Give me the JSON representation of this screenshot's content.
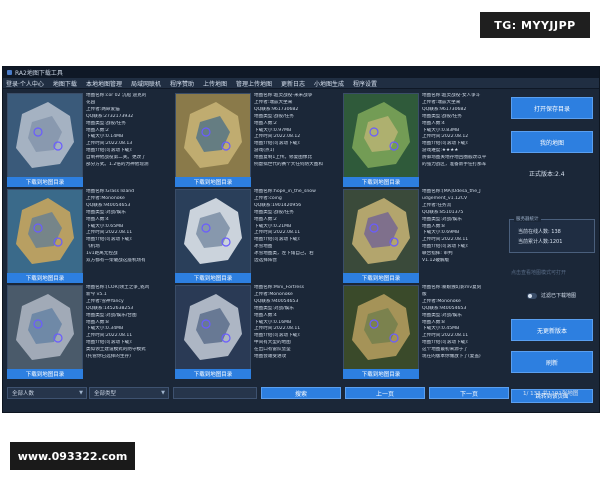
{
  "watermarks": {
    "tg": "TG: MYYJJPP",
    "site": "www.093322.com"
  },
  "window": {
    "title": "RA2地图下载工具"
  },
  "menu": [
    "登录·个人中心",
    "地图下载",
    "本地地图管理",
    "局域网联机",
    "程序赞助",
    "上传地图",
    "管理上传地图",
    "更新日志",
    "小地图生成",
    "程序设置"
  ],
  "cards": [
    {
      "thumb_colors": [
        "#3a5a7a",
        "#b9c2cf",
        "#7d8fa6"
      ],
      "download_label": "下载到地图目录",
      "lines": [
        "地图名称:cor 02 沉船 迪克的",
        "花园",
        "上传者:两命爱猫",
        "QQ联系:2732173932",
        "地图类型:战役/任务",
        "地图人数:2",
        "下载大小:0.14MB",
        "上传时间:2022.08.13",
        "地图介绍(可滚动下载):",
        "自制神他战役第二关。更改了",
        "部分方式。1.2倍的为神他现测"
      ]
    },
    {
      "thumb_colors": [
        "#8a7a4a",
        "#c9b577",
        "#3f6a8a"
      ],
      "download_label": "下载到地图目录",
      "lines": [
        "地图名称:超灵战役-米米战争",
        "上传者:瑞兹大坐来",
        "QQ联系:961730682",
        "地图类型:战役/任务",
        "地图人数:2",
        "下载大小:0.97MB",
        "上传时间:2022.08.12",
        "地图介绍(可滚动下载):",
        "游戏(点1)",
        "地图复制1上传。修复图像比",
        "例虚拟世代的赛个大任何防大图和"
      ]
    },
    {
      "thumb_colors": [
        "#2f5a3a",
        "#7fa85a",
        "#c8b97a"
      ],
      "download_label": "下载到地图目录",
      "lines": [
        "地图名称:超灵战役-女人争斗",
        "上传者:瑞兹大坐来",
        "QQ联系:961730682",
        "地图类型:战役/任务",
        "地图人数:4",
        "下载大小:0.83MB",
        "上传时间:2022.08.12",
        "地图介绍(可滚动下载):",
        "游戏难度:★★★★",
        "防御场图关地存地回圈般改以平",
        "的强力战区，准备新手任打那军"
      ]
    },
    {
      "thumb_colors": [
        "#3a6a8a",
        "#cfa85a",
        "#5a7a9a"
      ],
      "download_label": "下载到地图目录",
      "lines": [
        "地图名称:Grass Island",
        "上传者:Mononoke",
        "QQ联系:940054653",
        "地图类型:对战/娱乐",
        "地图人数:4",
        "下载大小:0.65MB",
        "上传时间:2022.08.11",
        "地图介绍(可滚动下载):",
        "飞机场",
        "1v1距离无控战",
        "双方都有一架破战这座机场有"
      ]
    },
    {
      "thumb_colors": [
        "#2a3f5a",
        "#e8edf3",
        "#6a7f99"
      ],
      "download_label": "下载到地图目录",
      "lines": [
        "地图名称:hope_in_the_snow",
        "上传者:coing",
        "QQ联系:1901420956",
        "地图类型:战役/任务",
        "地图人数:2",
        "下载大小:0.21MB",
        "上传时间:2022.08.11",
        "地图介绍(可滚动下载):",
        "冰雪地图",
        "冰雪地图类，左下角自己，右",
        "边选择阵营"
      ]
    },
    {
      "thumb_colors": [
        "#3a4a3a",
        "#c9b577",
        "#6a5a9a"
      ],
      "download_label": "下载到地图目录",
      "lines": [
        "地图名称:[MA]Odesa_the_J",
        "udgement_v1.12CV",
        "上传者:任务流",
        "QQ联系:85101375",
        "地图类型:对战/娱乐",
        "地图人数:8",
        "下载大小:0.69MB",
        "上传时间:2022.08.11",
        "地图介绍(可滚动下载):",
        "联合指挥: 审判",
        "V1.12破解版"
      ]
    },
    {
      "thumb_colors": [
        "#4a5a6a",
        "#b0b8c4",
        "#5a7aa0"
      ],
      "download_label": "下载到地图目录",
      "lines": [
        "地图名称:[COR]领土之争_乾鸡",
        "新今 v5.1",
        "上传者:雪神Yancy",
        "QQ联系:1452638253",
        "地图类型:对战/娱乐/合图",
        "地图人数:8",
        "下载大小:0.34MB",
        "上传时间:2022.08.11",
        "地图介绍(可滚动下载):",
        "类似领土建设模式的防守模式",
        "(托管你已选择的生存)"
      ]
    },
    {
      "thumb_colors": [
        "#2a3a55",
        "#c4ccd8",
        "#4a5f80"
      ],
      "download_label": "下载到地图目录",
      "lines": [
        "地图名称:Mini_Fortress",
        "上传者:Mononoke",
        "QQ联系:940054653",
        "地图类型:对战/娱乐",
        "地图人数:4",
        "下载大小:0.16MB",
        "上传时间:2022.08.11",
        "地图介绍(可滚动下载):",
        "中间有大型的地图",
        "在出口有雷队堡垒",
        "地图会遭受进攻"
      ]
    },
    {
      "thumb_colors": [
        "#3a4a2a",
        "#b8a060",
        "#6a7a4a"
      ],
      "download_label": "下载到地图目录",
      "lines": [
        "地图名称:暴娘独幻影mv复刻",
        "版",
        "上传者:Mononoke",
        "QQ联系:940054653",
        "地图类型:对战/娱乐",
        "地图人数:8",
        "下载大小:0.45MB",
        "上传时间:2022.08.11",
        "地图介绍(可滚动下载):",
        "这个地图最初来源于了",
        "现在的版本你做放下了(复盖)"
      ]
    }
  ],
  "right_panel": {
    "open_dir_label": "打开保存目录",
    "my_maps_label": "我的地图",
    "version_text": "正式版本:2.4",
    "stats_legend": "服务器统计",
    "online_users": "当前在线人数: 138",
    "today_users": "当前累计人数:1201",
    "faded_text": "点击查看地图模式可打开",
    "checkbox_label": "过滤已下载地图",
    "check_update_label": "无更新版本",
    "refresh_label": "刷新",
    "download_page_label": "跳转到该页面"
  },
  "bottom": {
    "players_select": "全部人数",
    "type_select": "全部类型",
    "search_label": "搜索",
    "prev_label": "上一页",
    "next_label": "下一页",
    "page_info": "1/ 133 共1191张地图"
  }
}
